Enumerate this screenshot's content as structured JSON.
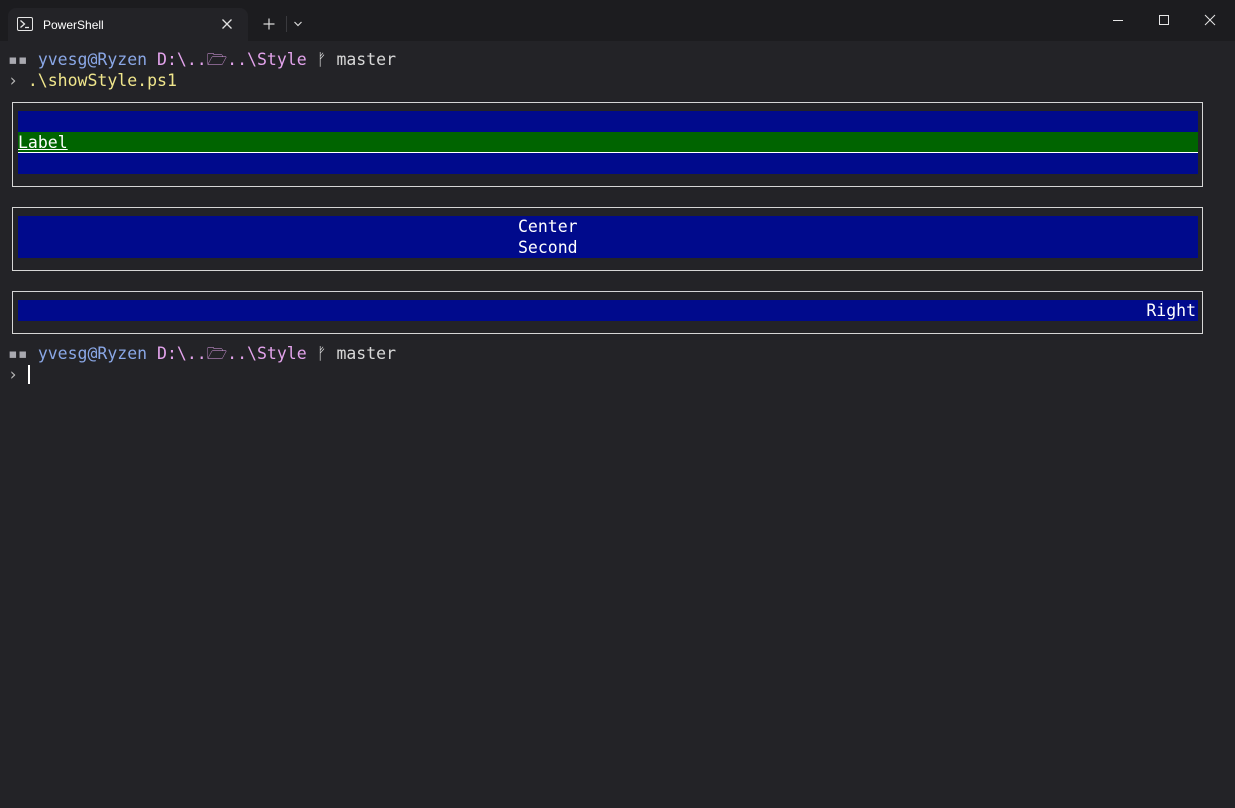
{
  "window": {
    "tab_title": "PowerShell",
    "icons": {
      "tab": "powershell-icon",
      "close_tab": "close-icon",
      "new_tab": "plus-icon",
      "dropdown": "chevron-down-icon",
      "minimize": "minimize-icon",
      "maximize": "maximize-icon",
      "close": "close-icon"
    }
  },
  "prompt1": {
    "glyph": "▪▪",
    "user": "yvesg@Ryzen",
    "path_prefix": "D:\\..",
    "folder_glyph": "🗁",
    "path_suffix": "..\\Style",
    "branch_glyph": "ᚠ",
    "branch": "master",
    "chevron": "›",
    "command": ".\\showStyle.ps1"
  },
  "boxes": {
    "box1": {
      "label": "Label",
      "colors": {
        "bar": "#000a8c",
        "highlight": "#006400"
      }
    },
    "box2": {
      "line1": "Center",
      "line2": "Second"
    },
    "box3": {
      "text": "Right"
    }
  },
  "prompt2": {
    "glyph": "▪▪",
    "user": "yvesg@Ryzen",
    "path_prefix": "D:\\..",
    "folder_glyph": "🗁",
    "path_suffix": "..\\Style",
    "branch_glyph": "ᚠ",
    "branch": "master",
    "chevron": "›"
  }
}
